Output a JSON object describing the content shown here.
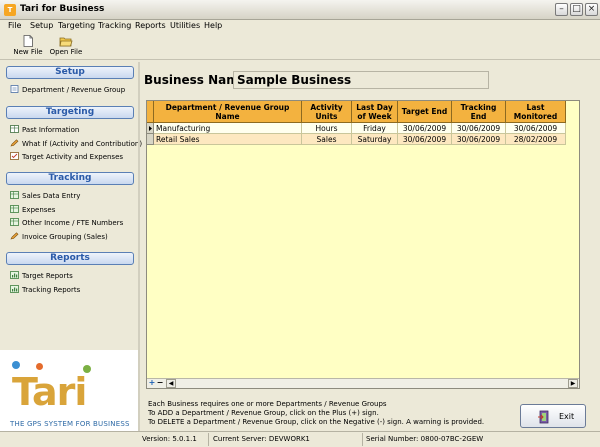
{
  "window": {
    "title": "Tari for Business",
    "app_icon": "tari-app-icon"
  },
  "menu": [
    "File",
    "Setup",
    "Targeting",
    "Tracking",
    "Reports",
    "Utilities",
    "Help"
  ],
  "toolbar": {
    "new_file": "New File",
    "open_file": "Open File"
  },
  "sidebar": {
    "setup": {
      "title": "Setup",
      "items": [
        "Department / Revenue Group"
      ]
    },
    "targeting": {
      "title": "Targeting",
      "items": [
        "Past Information",
        "What If (Activity and Contribution)",
        "Target Activity and Expenses"
      ]
    },
    "tracking": {
      "title": "Tracking",
      "items": [
        "Sales Data Entry",
        "Expenses",
        "Other Income / FTE Numbers",
        "Invoice Grouping (Sales)"
      ]
    },
    "reports": {
      "title": "Reports",
      "items": [
        "Target Reports",
        "Tracking Reports"
      ]
    }
  },
  "logo": {
    "word": "Tari",
    "tagline": "THE GPS SYSTEM FOR BUSINESS"
  },
  "business": {
    "label": "Business Name",
    "value": "Sample Business"
  },
  "grid": {
    "columns": [
      "Department / Revenue Group Name",
      "Activity Units",
      "Last Day of Week",
      "Target End",
      "Tracking End",
      "Last Monitored"
    ],
    "rows": [
      [
        "Manufacturing",
        "Hours",
        "Friday",
        "30/06/2009",
        "30/06/2009",
        "30/06/2009"
      ],
      [
        "Retail Sales",
        "Sales",
        "Saturday",
        "30/06/2009",
        "30/06/2009",
        "28/02/2009"
      ]
    ],
    "add_symbol": "+",
    "remove_symbol": "−"
  },
  "help": [
    "Each Business requires one or more Departments / Revenue Groups",
    "To ADD a Department / Revenue Group, click on the Plus (+) sign.",
    "To DELETE a Department / Revenue Group, click on the Negative (-) sign. A warning is provided."
  ],
  "exit_label": "Exit",
  "status": {
    "version": "Version: 5.0.1.1",
    "server": "Current Server: DEVWORK1",
    "serial": "Serial Number: 0800-07BC-2GEW"
  },
  "colors": {
    "header_orange": "#f3b23f",
    "grid_bg": "#ffffc4",
    "selected_green": "#b8e7a5",
    "section_blue": "#2a5aa8"
  }
}
